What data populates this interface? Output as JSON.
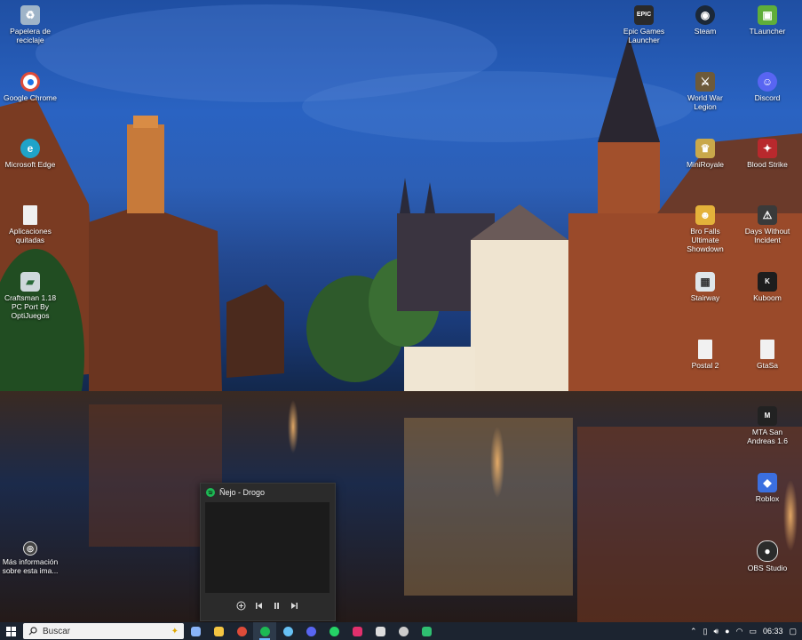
{
  "desktop": {
    "icons_left": [
      {
        "label": "Papelera de reciclaje",
        "icon": "recycle-bin-icon",
        "color": "#9fb4c8"
      },
      {
        "label": "Google Chrome",
        "icon": "chrome-icon",
        "color": "#dd4b39"
      },
      {
        "label": "Microsoft Edge",
        "icon": "edge-icon",
        "color": "#1fa3c9"
      },
      {
        "label": "Aplicaciones quitadas",
        "icon": "document-icon",
        "color": "#f0f0f0"
      },
      {
        "label": "Craftsman 1.18 PC Port By OptiJuegos",
        "icon": "craftsman-icon",
        "color": "#cfd8dc"
      },
      {
        "label": "Más información sobre esta ima...",
        "icon": "camera-info-icon",
        "color": "#444444"
      }
    ],
    "icons_right_col1": [
      {
        "label": "Epic Games Launcher",
        "icon": "epic-games-icon",
        "color": "#2a2a2a"
      },
      {
        "label": "World War Legion",
        "icon": "world-war-legion-icon",
        "color": "#6d5a3a"
      },
      {
        "label": "MiniRoyale",
        "icon": "miniroyale-icon",
        "color": "#c9a84a"
      },
      {
        "label": "Bro Falls Ultimate Showdown",
        "icon": "bro-falls-icon",
        "color": "#e4b23a"
      },
      {
        "label": "Stairway",
        "icon": "stairway-icon",
        "color": "#dfe6ea"
      },
      {
        "label": "Postal 2",
        "icon": "postal2-icon",
        "color": "#f1f1f1"
      }
    ],
    "icons_right_col2": [
      {
        "label": "Steam",
        "icon": "steam-icon",
        "color": "#1b2838"
      },
      {
        "label": "Discord",
        "icon": "discord-icon",
        "color": "#5865f2"
      },
      {
        "label": "Blood Strike",
        "icon": "blood-strike-icon",
        "color": "#b8292d"
      },
      {
        "label": "Days Without Incident",
        "icon": "days-without-incident-icon",
        "color": "#3a3a3a"
      },
      {
        "label": "Kuboom",
        "icon": "kuboom-icon",
        "color": "#1d1d1d"
      },
      {
        "label": "GtaSa",
        "icon": "gtasa-icon",
        "color": "#f1f1f1"
      },
      {
        "label": "MTA San Andreas 1.6",
        "icon": "mta-icon",
        "color": "#222222"
      },
      {
        "label": "Roblox",
        "icon": "roblox-icon",
        "color": "#3b6fe0"
      },
      {
        "label": "OBS Studio",
        "icon": "obs-icon",
        "color": "#2b2b2b"
      }
    ],
    "icons_top_right": [
      {
        "label": "TLauncher",
        "icon": "tlauncher-icon",
        "color": "#5fae3a"
      }
    ]
  },
  "spotify_popup": {
    "title": "Ñejo - Drogo",
    "brand_color": "#1db954",
    "controls": [
      "add-icon",
      "previous-icon",
      "pause-icon",
      "next-icon"
    ]
  },
  "taskbar": {
    "search_placeholder": "Buscar",
    "apps": [
      {
        "icon": "task-view-icon",
        "color": "#8ab4f8"
      },
      {
        "icon": "file-explorer-icon",
        "color": "#f4c542"
      },
      {
        "icon": "chrome-icon",
        "color": "#dd4b39"
      },
      {
        "icon": "spotify-icon",
        "color": "#1db954",
        "active": true
      },
      {
        "icon": "steam-icon",
        "color": "#66c0f4"
      },
      {
        "icon": "discord-icon",
        "color": "#5865f2"
      },
      {
        "icon": "whatsapp-icon",
        "color": "#25d366"
      },
      {
        "icon": "instagram-icon",
        "color": "#e1306c"
      },
      {
        "icon": "epic-games-icon",
        "color": "#dddddd"
      },
      {
        "icon": "obs-icon",
        "color": "#cccccc"
      },
      {
        "icon": "app-icon",
        "color": "#2fbf71"
      }
    ],
    "clock": "06:33"
  }
}
